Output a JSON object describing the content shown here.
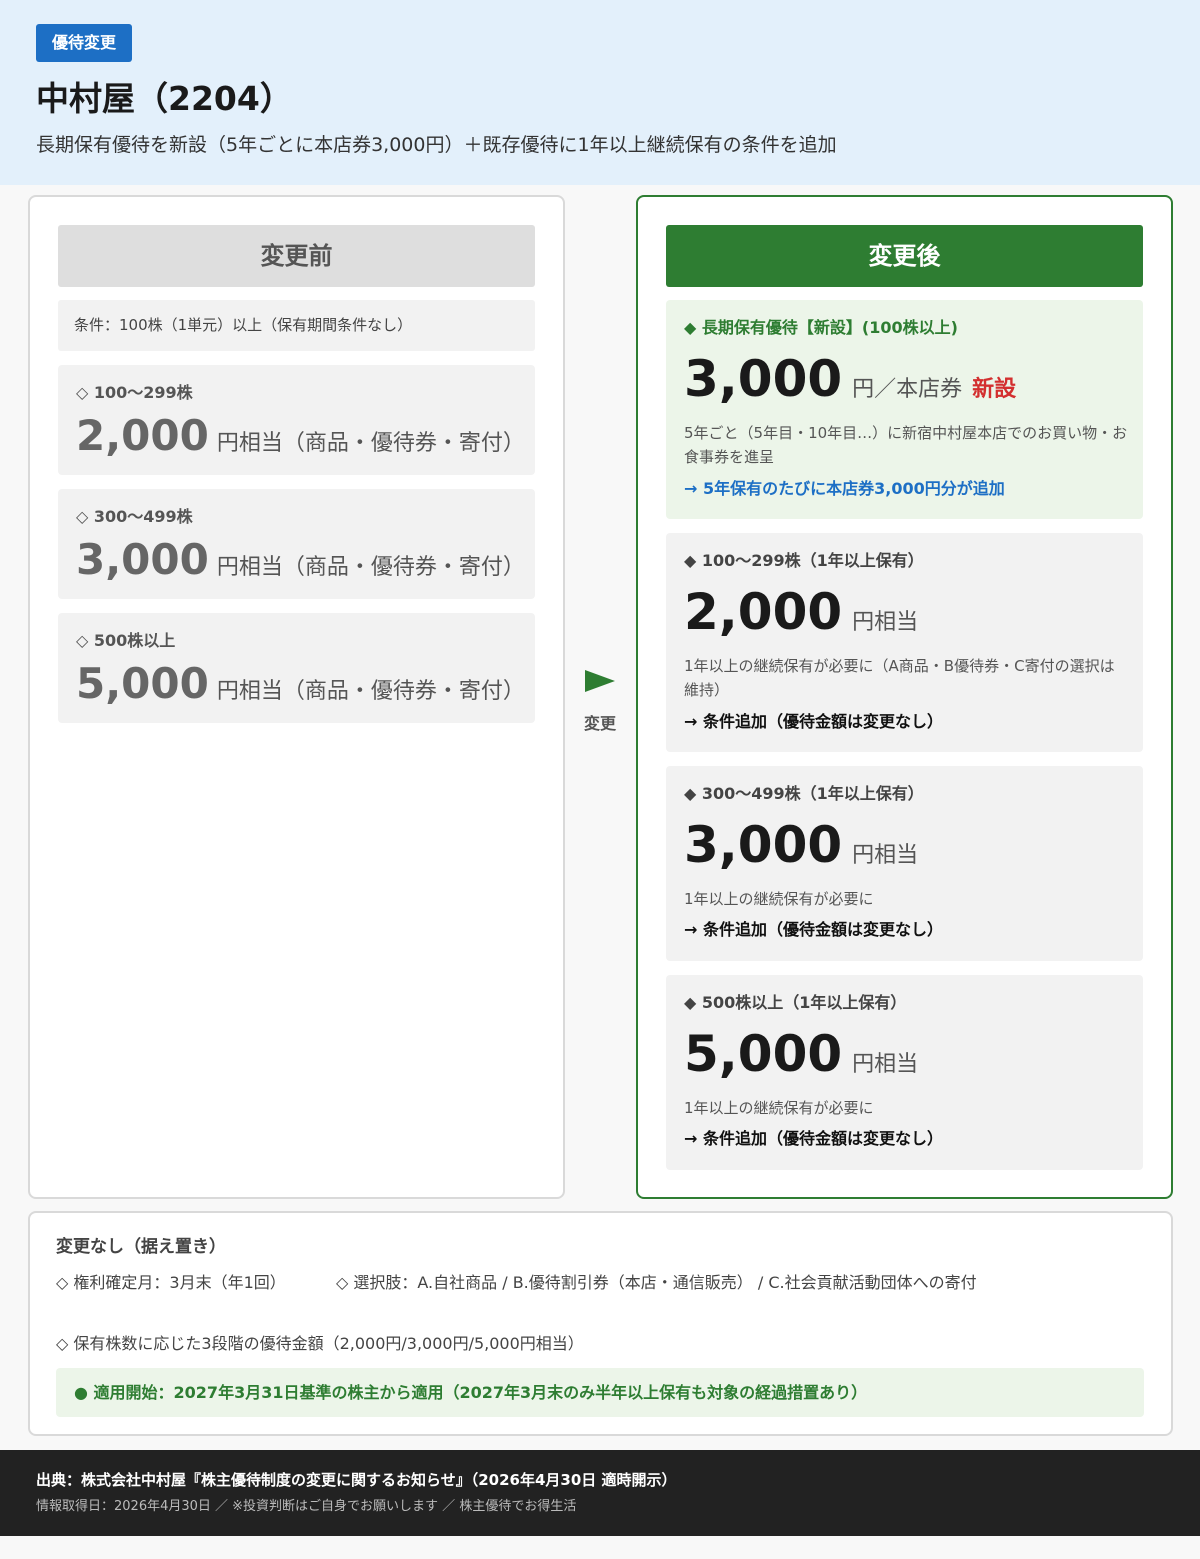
{
  "header": {
    "badge": "優待変更",
    "title": "中村屋（2204）",
    "subtitle": "長期保有優待を新設（5年ごとに本店券3,000円）＋既存優待に1年以上継続保有の条件を追加"
  },
  "before": {
    "heading": "変更前",
    "condition": "条件：100株（1単元）以上（保有期間条件なし）",
    "tiers": [
      {
        "label": "◇ 100〜299株",
        "amount": "2,000",
        "unit": "円相当（商品・優待券・寄付）"
      },
      {
        "label": "◇ 300〜499株",
        "amount": "3,000",
        "unit": "円相当（商品・優待券・寄付）"
      },
      {
        "label": "◇ 500株以上",
        "amount": "5,000",
        "unit": "円相当（商品・優待券・寄付）"
      }
    ]
  },
  "arrow": {
    "label": "変更",
    "icon": "arrow-right-icon",
    "color": "#2e7d32"
  },
  "after": {
    "heading": "変更後",
    "new_tier": {
      "label": "◆ 長期保有優待【新設】(100株以上)",
      "amount": "3,000",
      "unit": "円／本店券",
      "tag": "新設",
      "desc": "5年ごと（5年目・10年目…）に新宿中村屋本店でのお買い物・お食事券を進呈",
      "note": "→ 5年保有のたびに本店券3,000円分が追加"
    },
    "tiers": [
      {
        "label": "◆ 100〜299株（1年以上保有）",
        "amount": "2,000",
        "unit": "円相当",
        "desc": "1年以上の継続保有が必要に（A商品・B優待券・C寄付の選択は維持）",
        "note": "→ 条件追加（優待金額は変更なし）"
      },
      {
        "label": "◆ 300〜499株（1年以上保有）",
        "amount": "3,000",
        "unit": "円相当",
        "desc": "1年以上の継続保有が必要に",
        "note": "→ 条件追加（優待金額は変更なし）"
      },
      {
        "label": "◆ 500株以上（1年以上保有）",
        "amount": "5,000",
        "unit": "円相当",
        "desc": "1年以上の継続保有が必要に",
        "note": "→ 条件追加（優待金額は変更なし）"
      }
    ]
  },
  "unchanged": {
    "title": "変更なし（据え置き）",
    "items": [
      "◇ 権利確定月：3月末（年1回）",
      "◇ 選択肢：A.自社商品 / B.優待割引券（本店・通信販売） / C.社会貢献活動団体への寄付",
      "◇ 保有株数に応じた3段階の優待金額（2,000円/3,000円/5,000円相当）"
    ],
    "apply": "● 適用開始：2027年3月31日基準の株主から適用（2027年3月末のみ半年以上保有も対象の経過措置あり）"
  },
  "footer": {
    "source": "出典：株式会社中村屋『株主優待制度の変更に関するお知らせ』（2026年4月30日 適時開示）",
    "info": "情報取得日：2026年4月30日 ／ ※投資判断はご自身でお願いします ／ 株主優待でお得生活"
  },
  "colors": {
    "header_bg": "#e3f0fb",
    "badge": "#1d6fc5",
    "after_accent": "#2e7d32",
    "new_tag": "#d32f2f"
  }
}
